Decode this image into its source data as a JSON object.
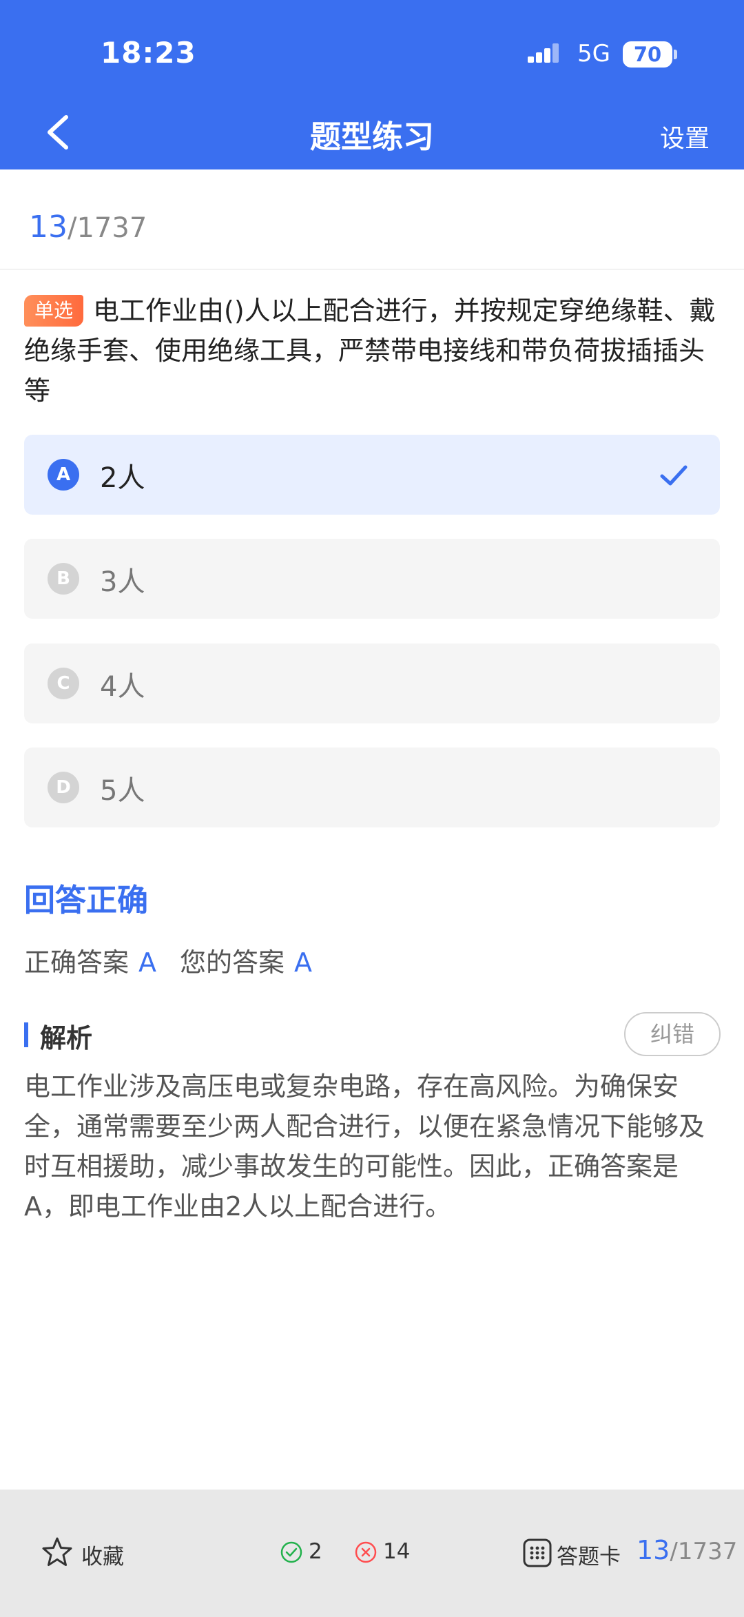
{
  "status_bar": {
    "time": "18:23",
    "network": "5G",
    "battery": "70"
  },
  "header": {
    "title": "题型练习",
    "settings_label": "设置",
    "back_icon": "chevron-left-icon"
  },
  "progress": {
    "current": "13",
    "total": "/1737"
  },
  "question": {
    "type_badge": "单选",
    "text": "电工作业由()人以上配合进行，并按规定穿绝缘鞋、戴绝缘手套、使用绝缘工具，严禁带电接线和带负荷拔插插头等"
  },
  "options": [
    {
      "letter": "A",
      "text": "2人",
      "selected": true
    },
    {
      "letter": "B",
      "text": "3人",
      "selected": false
    },
    {
      "letter": "C",
      "text": "4人",
      "selected": false
    },
    {
      "letter": "D",
      "text": "5人",
      "selected": false
    }
  ],
  "result": {
    "status": "回答正确",
    "correct_label": "正确答案",
    "correct_value": "A",
    "your_label": "您的答案",
    "your_value": "A"
  },
  "analysis": {
    "title": "解析",
    "report_button": "纠错",
    "text": "电工作业涉及高压电或复杂电路，存在高风险。为确保安全，通常需要至少两人配合进行，以便在紧急情况下能够及时互相援助，减少事故发生的可能性。因此，正确答案是A，即电工作业由2人以上配合进行。"
  },
  "bottom_bar": {
    "favorite_label": "收藏",
    "correct_count": "2",
    "wrong_count": "14",
    "answer_card_label": "答题卡",
    "progress_current": "13",
    "progress_total": "/1737"
  },
  "colors": {
    "primary": "#3a6ff0",
    "badge": "#ff7a45",
    "correct": "#22b14c",
    "wrong": "#ff4d4f"
  }
}
